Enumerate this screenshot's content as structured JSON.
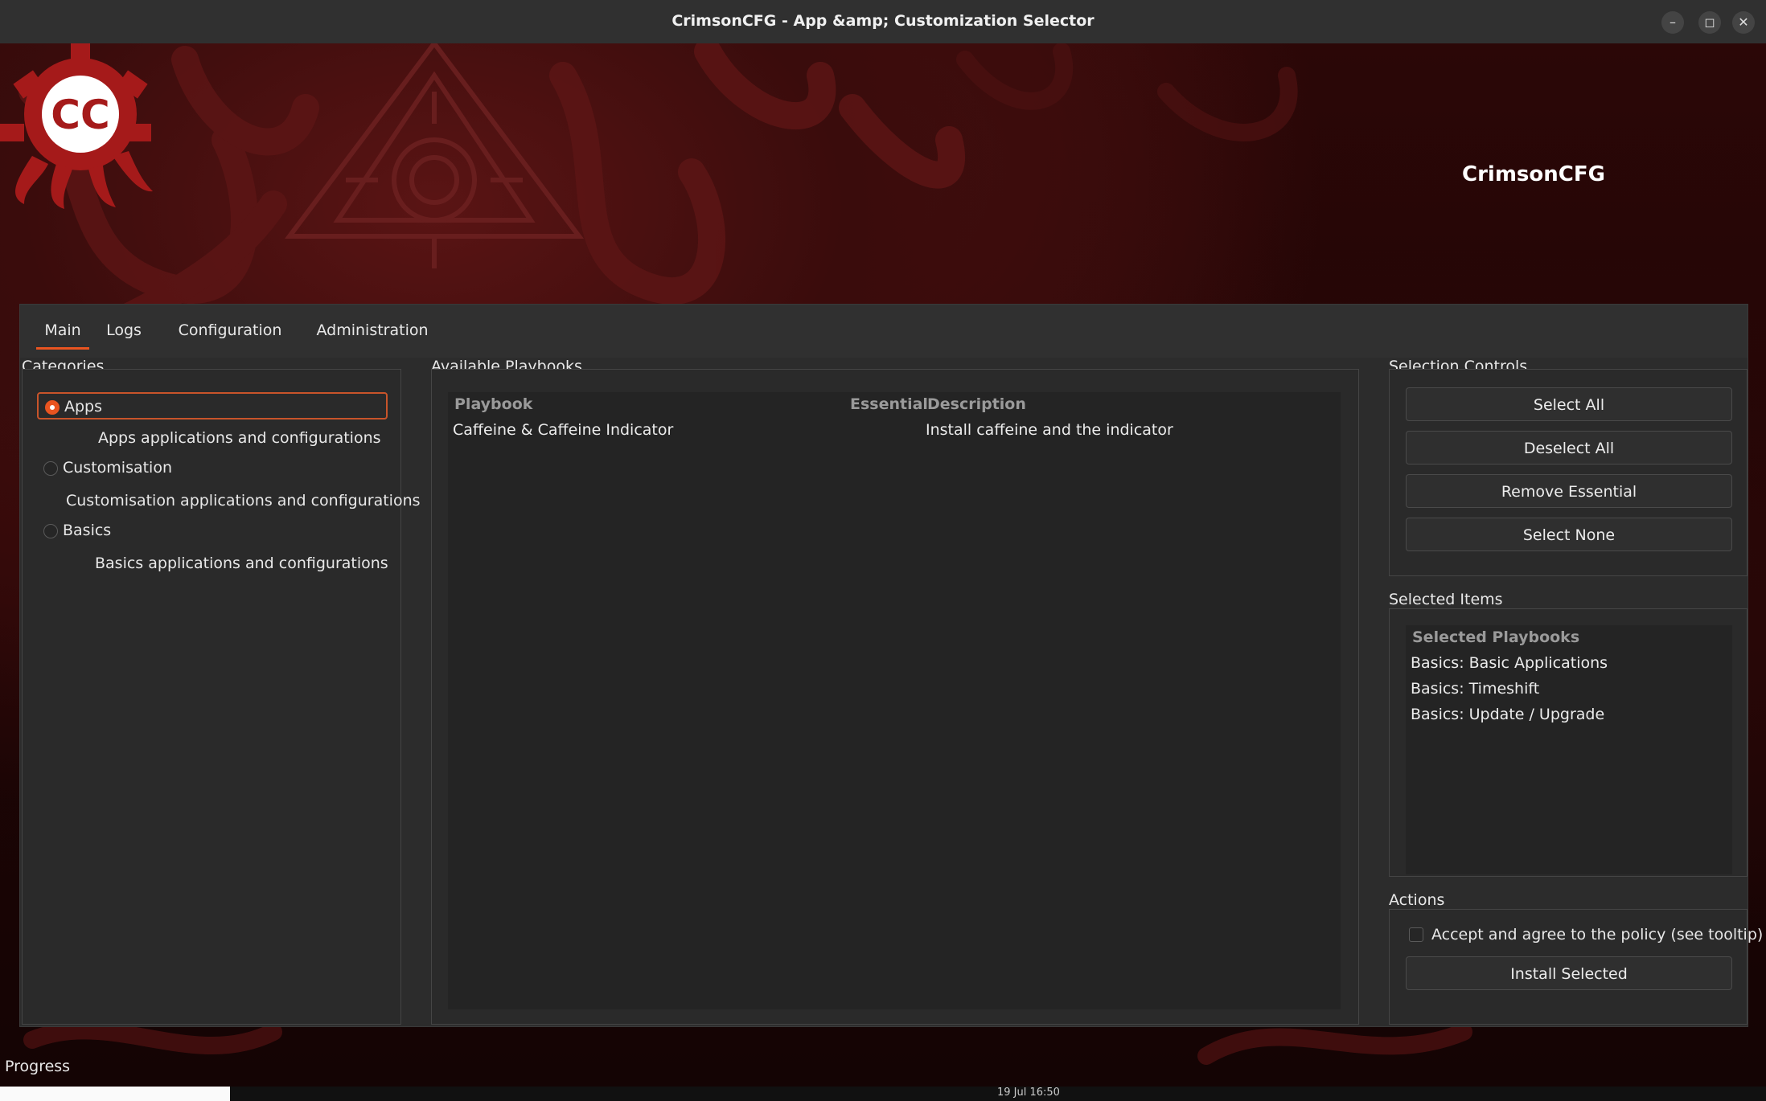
{
  "window": {
    "title": "CrimsonCFG - App &amp; Customization Selector",
    "minimize_icon": "minimize-icon",
    "maximize_icon": "maximize-icon",
    "close_icon": "close-icon"
  },
  "banner": {
    "brand": "CrimsonCFG",
    "logo_text": "CC",
    "accent": "#8b1414"
  },
  "tabs": [
    {
      "label": "Main",
      "active": true
    },
    {
      "label": "Logs",
      "active": false
    },
    {
      "label": "Configuration",
      "active": false
    },
    {
      "label": "Administration",
      "active": false
    }
  ],
  "categories": {
    "label": "Categories",
    "items": [
      {
        "name": "Apps",
        "description": "Apps applications and configurations",
        "selected": true
      },
      {
        "name": "Customisation",
        "description": "Customisation applications and configurations",
        "selected": false
      },
      {
        "name": "Basics",
        "description": "Basics applications and configurations",
        "selected": false
      }
    ]
  },
  "playbooks": {
    "label": "Available Playbooks",
    "columns": [
      "Playbook",
      "Essential",
      "Description"
    ],
    "rows": [
      {
        "playbook": "Caffeine & Caffeine Indicator",
        "essential": "",
        "description": "Install caffeine and the indicator"
      }
    ]
  },
  "selection_controls": {
    "label": "Selection Controls",
    "buttons": [
      "Select All",
      "Deselect All",
      "Remove Essential",
      "Select None"
    ]
  },
  "selected_items": {
    "label": "Selected Items",
    "header": "Selected Playbooks",
    "items": [
      "Basics: Basic Applications",
      "Basics: Timeshift",
      "Basics: Update / Upgrade"
    ]
  },
  "actions": {
    "label": "Actions",
    "policy_checkbox": "Accept and agree to the policy (see tooltip)",
    "policy_checked": false,
    "install_button": "Install Selected"
  },
  "status": {
    "progress_label": "Progress"
  },
  "taskbar": {
    "clock": "19 Jul 16:50"
  }
}
